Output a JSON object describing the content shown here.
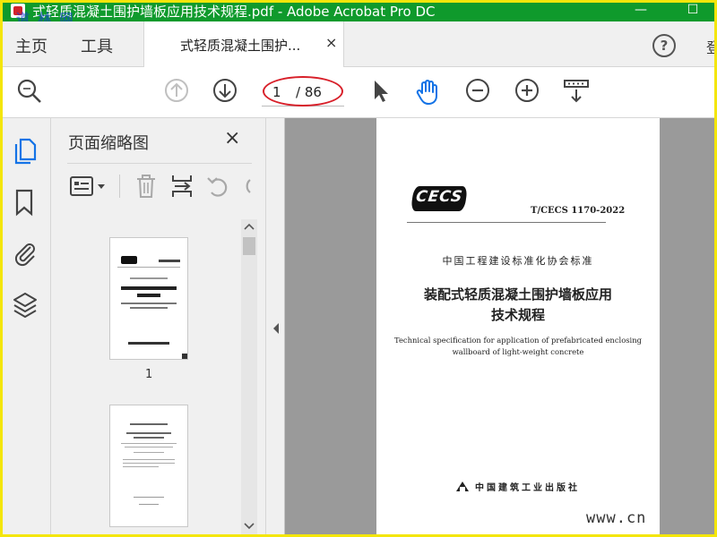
{
  "window": {
    "title": "式轻质混凝土围护墙板应用技术规程.pdf - Adobe Acrobat Pro DC",
    "watermark": "道 林 网",
    "minimize": "—",
    "maximize": "☐"
  },
  "tabs": {
    "home": "主页",
    "tools": "工具",
    "document": "式轻质混凝土围护...",
    "close": "×",
    "help": "?",
    "signin": "登"
  },
  "toolbar": {
    "page_current": "1",
    "page_total": "/ 86"
  },
  "thumbnails_panel": {
    "title": "页面缩略图",
    "close": "×",
    "pages": [
      {
        "label": "1"
      }
    ]
  },
  "document_page": {
    "logo": "CECS",
    "code": "T/CECS 1170-2022",
    "org": "中国工程建设标准化协会标准",
    "title_line1": "装配式轻质混凝土围护墙板应用",
    "title_line2": "技术规程",
    "en_line1": "Technical specification for application of prefabricated enclosing",
    "en_line2": "wallboard of light-weight concrete",
    "publisher": "中国建筑工业出版社"
  },
  "watermark_bottom": "www.cn",
  "colors": {
    "titlebar": "#0f9a2c",
    "accent_blue": "#1473e6",
    "annotation_red": "#d8202a",
    "frame_yellow": "#f4e60a"
  }
}
